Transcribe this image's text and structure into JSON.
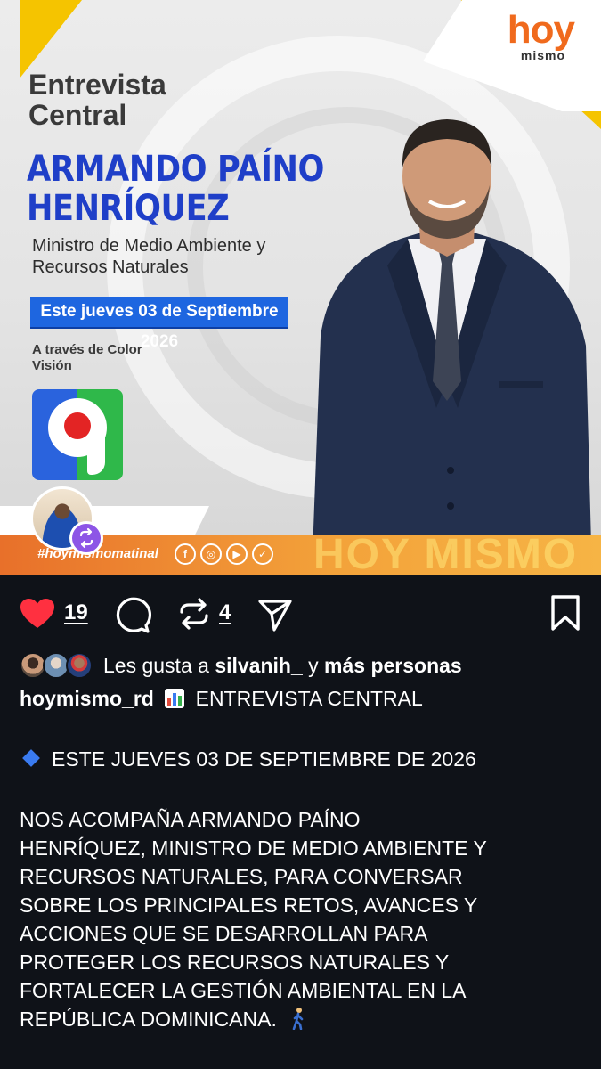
{
  "post": {
    "logo_text_hoy": "hoy",
    "logo_text_mismo": "mismo",
    "title_small": "Entrevista Central",
    "name": "ARMANDO PAÍNO HENRÍQUEZ",
    "role": "Ministro de Medio Ambiente y Recursos Naturales",
    "date_banner": "Este jueves 03 de Septiembre 2026",
    "via": "A través de Color Visión",
    "hashtag": "#hoymismomatinal",
    "strip_brand": "HOY MISMO",
    "social_icons": [
      "facebook-icon",
      "instagram-icon",
      "youtube-icon",
      "twitter-icon"
    ]
  },
  "actions": {
    "like_count": "19",
    "repost_count": "4"
  },
  "likes": {
    "prefix": "Les gusta a ",
    "user": "silvanih_",
    "middle": " y ",
    "suffix": "más personas"
  },
  "caption": {
    "username": "hoymismo_rd",
    "headline": "ENTREVISTA CENTRAL",
    "date_line": "ESTE JUEVES 03 DE SEPTIEMBRE DE 2026",
    "body_lines": [
      "NOS ACOMPAÑA ARMANDO PAÍNO",
      "HENRÍQUEZ, MINISTRO DE MEDIO AMBIENTE Y",
      "RECURSOS NATURALES, PARA CONVERSAR",
      "SOBRE LOS PRINCIPALES RETOS, AVANCES Y",
      "ACCIONES QUE SE DESARROLLAN PARA",
      "PROTEGER LOS RECURSOS NATURALES Y",
      "FORTALECER LA GESTIÓN AMBIENTAL EN LA",
      "REPÚBLICA DOMINICANA."
    ]
  },
  "colors": {
    "like_red": "#ff3040",
    "name_blue": "#1f3fc8",
    "banner_blue": "#1e66e0",
    "accent_yellow": "#f5c400",
    "strip_orange": "#e8702a",
    "background": "#0f1218"
  }
}
